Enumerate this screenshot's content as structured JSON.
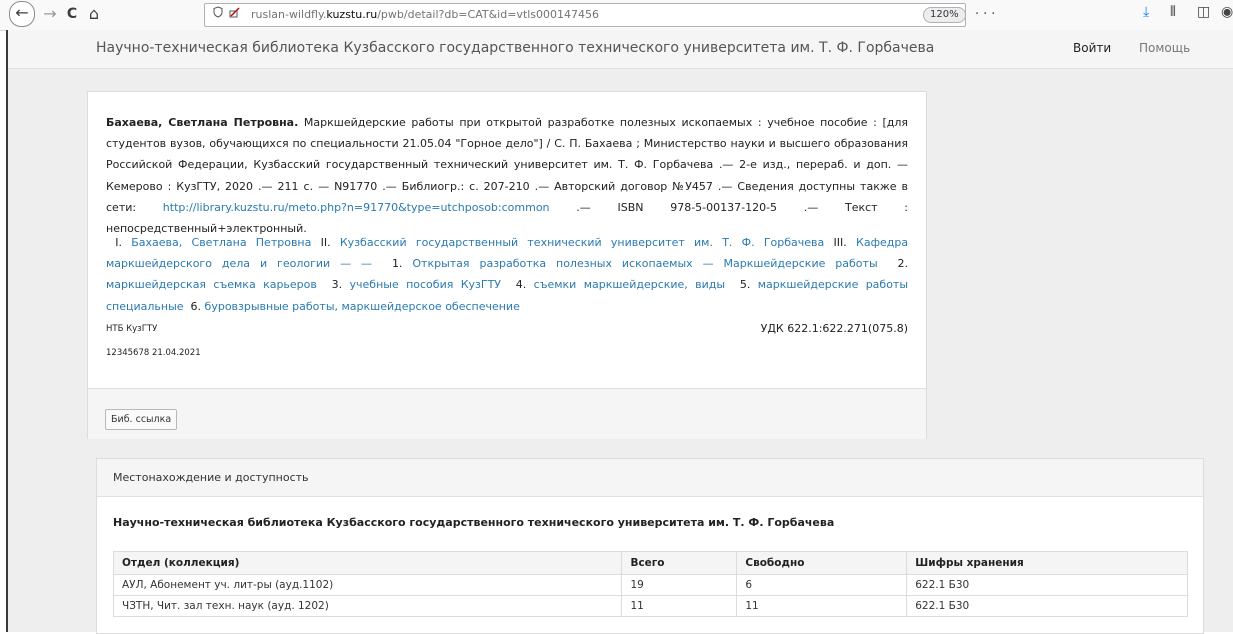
{
  "browser": {
    "back_glyph": "←",
    "forward_glyph": "→",
    "reload_glyph": "C",
    "home_glyph": "⌂",
    "url_prefix": "ruslan-wildfly.",
    "url_host": "kuzstu.ru",
    "url_path": "/pwb/detail?db=CAT&id=vtls000147456",
    "zoom": "120%",
    "actions": "··· ♡ ☆"
  },
  "header": {
    "site_title": "Научно-техническая библиотека Кузбасского государственного технического университета им. Т. Ф. Горбачева",
    "login": "Войти",
    "help": "Помощь"
  },
  "record": {
    "author": "Бахаева, Светлана Петровна.",
    "description_1": " Маркшейдерские работы при открытой разработке полезных ископаемых : учебное пособие : [для студентов вузов, обучающихся по специальности 21.05.04 \"Горное дело\"] / С. П. Бахаева ; Министерство науки и высшего образования Российской Федерации, Кузбасский государственный технический университет им. Т. Ф. Горбачева .— 2-е изд., перераб. и доп. — Кемерово : КузГТУ, 2020 .— 211 с. — N91770 .— Библиогр.: с. 207-210 .— Авторский договор №У457 .— Сведения доступны также в сети: ",
    "url": "http://library.kuzstu.ru/meto.php?n=91770&type=utchposob:common",
    "description_2": " .— ISBN 978-5-00137-120-5 .— Текст : непосредственный+электронный.",
    "subjects": [
      {
        "num": "I.",
        "label": "Бахаева, Светлана Петровна"
      },
      {
        "num": "II.",
        "label": "Кузбасский государственный технический университет им. Т. Ф. Горбачева"
      },
      {
        "num": "III.",
        "label": "Кафедра маркшейдерского дела и геологии — —"
      },
      {
        "num": "1.",
        "label": "Открытая разработка полезных ископаемых — Маркшейдерские работы"
      },
      {
        "num": "2.",
        "label": "маркшейдерская съемка карьеров"
      },
      {
        "num": "3.",
        "label": "учебные пособия КузГТУ"
      },
      {
        "num": "4.",
        "label": "съемки маркшейдерские, виды"
      },
      {
        "num": "5.",
        "label": "маркшейдерские работы специальные"
      },
      {
        "num": "6.",
        "label": "буровзрывные работы, маркшейдерское обеспечение"
      }
    ],
    "holder": "НТБ КузГТУ",
    "udc": "УДК   622.1:622.271(075.8)",
    "record_id": "12345678 21.04.2021",
    "bib_button": "Биб. ссылка"
  },
  "location": {
    "title": "Местонахождение и доступность",
    "library": "Научно-техническая библиотека Кузбасского государственного технического университета им. Т. Ф. Горбачева",
    "columns": [
      "Отдел (коллекция)",
      "Всего",
      "Свободно",
      "Шифры хранения"
    ],
    "rows": [
      [
        "АУЛ, Абонемент уч. лит-ры (ауд.1102)",
        "19",
        "6",
        "622.1 Б30"
      ],
      [
        "ЧЗТН, Чит. зал техн. наук (ауд. 1202)",
        "11",
        "11",
        "622.1 Б30"
      ]
    ]
  }
}
